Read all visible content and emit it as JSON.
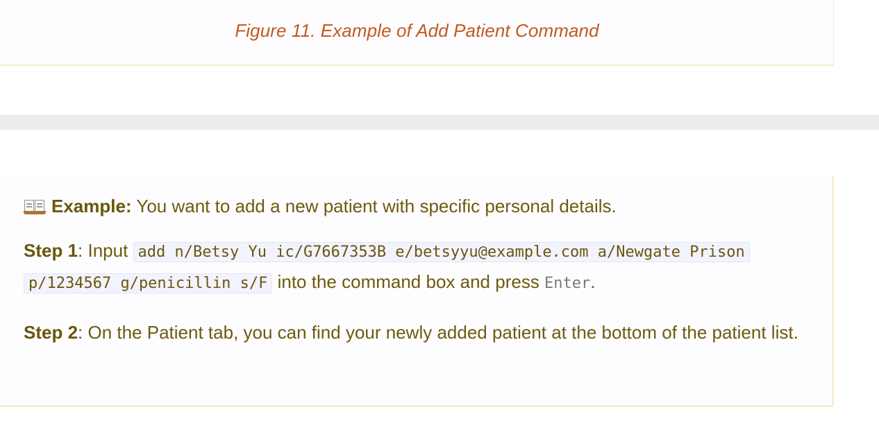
{
  "figure": {
    "caption": "Figure 11. Example of Add Patient Command"
  },
  "example": {
    "icon": "open-book-icon",
    "label": "Example:",
    "intro": " You want to add a new patient with specific personal details.",
    "step1": {
      "label": "Step 1",
      "before": ": Input ",
      "command": "add n/Betsy Yu ic/G7667353B e/betsyyu@example.com a/Newgate Prison p/1234567 g/penicillin s/F",
      "after": " into the command box and press ",
      "key": "Enter",
      "end": "."
    },
    "step2": {
      "label": "Step 2",
      "text": ": On the Patient tab, you can find your newly added patient at the bottom of the patient list."
    }
  },
  "colors": {
    "caption": "#c05a1f",
    "text": "#6e5a0d",
    "border": "#f6e9bf",
    "band": "#ececec"
  }
}
